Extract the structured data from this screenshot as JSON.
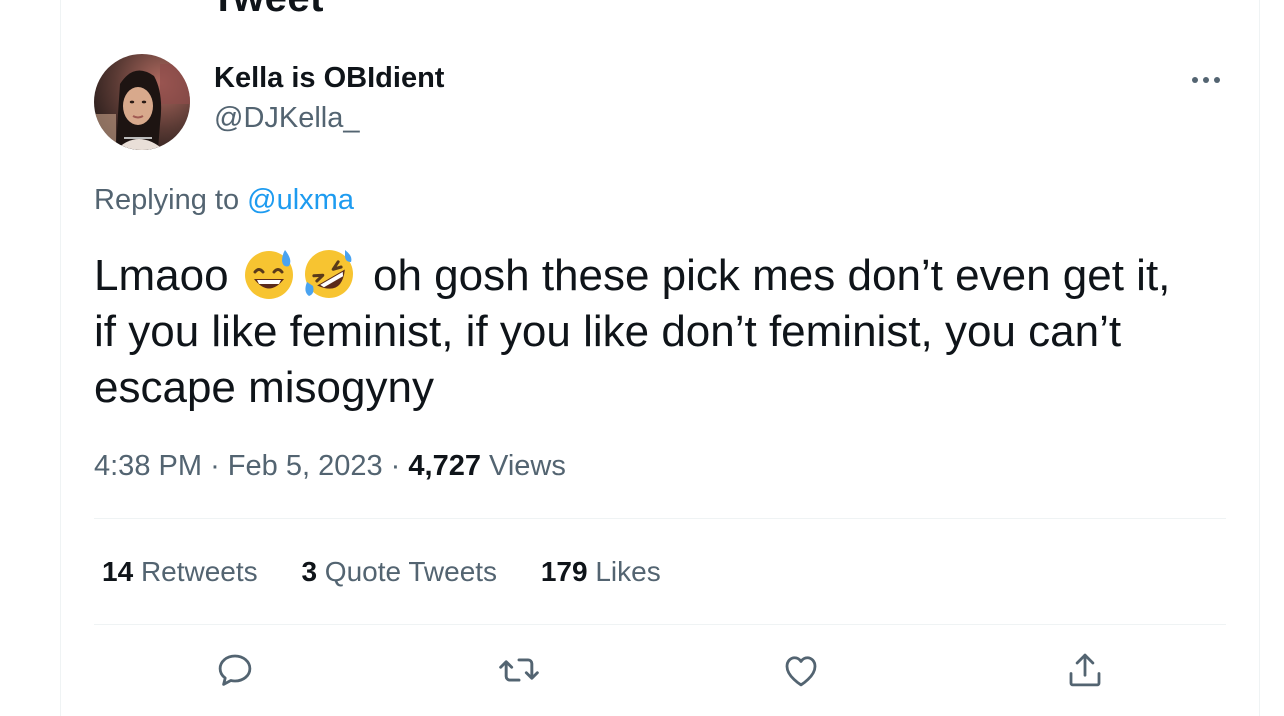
{
  "header": {
    "title": "Tweet"
  },
  "author": {
    "display_name": "Kella is OBIdient",
    "handle": "@DJKella_"
  },
  "reply": {
    "prefix": "Replying to ",
    "to_handle": "@ulxma"
  },
  "tweet": {
    "text_start": "Lmaoo",
    "emojis": [
      "grinning-sweat-emoji",
      "rolling-on-floor-laughing-emoji"
    ],
    "text_rest": "oh gosh these pick mes don’t even get it, if you like feminist, if you like don’t feminist, you can’t escape misogyny"
  },
  "meta": {
    "time": "4:38 PM",
    "date": "Feb 5, 2023",
    "separator": "·",
    "views_count": "4,727",
    "views_label": "Views"
  },
  "stats": {
    "retweets_count": "14",
    "retweets_label": "Retweets",
    "quotes_count": "3",
    "quotes_label": "Quote Tweets",
    "likes_count": "179",
    "likes_label": "Likes"
  },
  "actions": [
    {
      "icon": "reply-icon"
    },
    {
      "icon": "retweet-icon"
    },
    {
      "icon": "like-icon"
    },
    {
      "icon": "share-icon"
    }
  ],
  "colors": {
    "text_primary": "#0f1419",
    "text_secondary": "#536471",
    "link": "#1d9bf0",
    "divider": "#eff3f4"
  }
}
